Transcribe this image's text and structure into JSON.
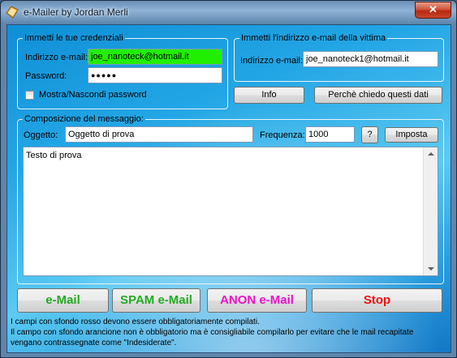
{
  "window": {
    "title": "e-Mailer by Jordan Merli",
    "close_label": "✕"
  },
  "credentials": {
    "legend": "Immetti le tue credenziali",
    "email_label": "Indirizzo e-mail:",
    "email_value": "joe_nanoteck@hotmail.it",
    "email_bg": "#22ee00",
    "password_label": "Password:",
    "password_value": "●●●●●",
    "show_password_label": "Mostra/Nascondi password",
    "show_password_checked": false
  },
  "victim": {
    "legend": "Immetti l'indirizzo e-mail della vittima",
    "email_label": "Indirizzo e-mail:",
    "email_value": "joe_nanoteck1@hotmail.it"
  },
  "buttons": {
    "info": "Info",
    "why": "Perchè chiedo questi dati",
    "help": "?",
    "set": "Imposta",
    "email": "e-Mail",
    "spam": "SPAM e-Mail",
    "anon": "ANON e-Mail",
    "stop": "Stop"
  },
  "colors": {
    "email": "#22aa22",
    "spam": "#22aa22",
    "anon": "#ee10c8",
    "stop": "#ee1010"
  },
  "compose": {
    "legend": "Composizione del messaggio:",
    "subject_label": "Oggetto:",
    "subject_value": "Oggetto di prova",
    "frequency_label": "Frequenza:",
    "frequency_value": "1000",
    "body_value": "Testo di prova"
  },
  "notes": {
    "line1": "I campi con sfondo rosso devono essere obbligatoriamente compilati.",
    "line2": "Il campo con sfondo arancione non è obbligatorio ma è consigliabile compilarlo per evitare che le mail recapitate",
    "line3": "vengano contrassegnate come \"Indesiderate\"."
  }
}
